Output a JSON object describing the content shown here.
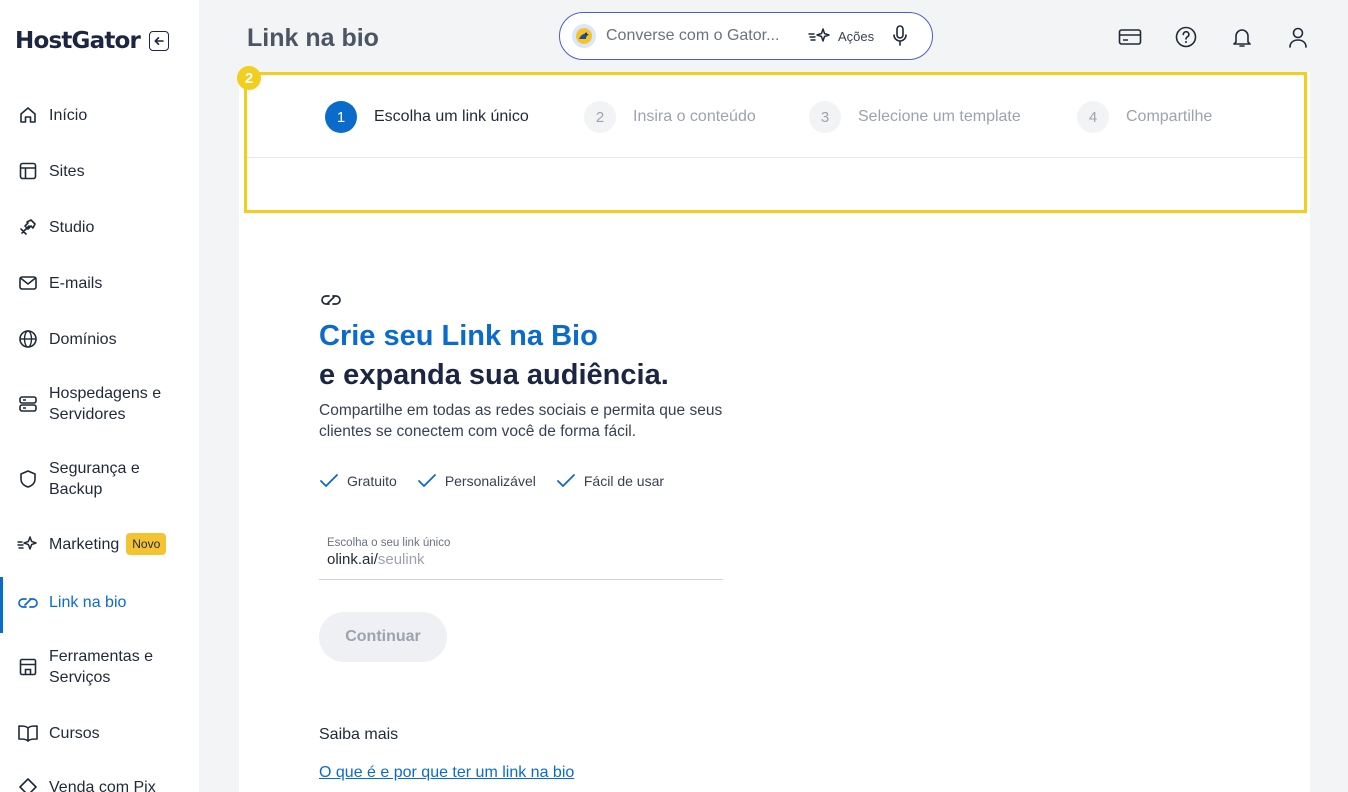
{
  "app": {
    "logo": "HostGator",
    "page_title": "Link na bio"
  },
  "sidebar": {
    "items": [
      {
        "label": "Início",
        "icon": "home-icon"
      },
      {
        "label": "Sites",
        "icon": "layout-icon"
      },
      {
        "label": "Studio",
        "icon": "tools-icon"
      },
      {
        "label": "E-mails",
        "icon": "mail-icon"
      },
      {
        "label": "Domínios",
        "icon": "globe-icon"
      },
      {
        "label": "Hospedagens e Servidores",
        "icon": "server-icon"
      },
      {
        "label": "Segurança e Backup",
        "icon": "shield-icon"
      },
      {
        "label": "Marketing",
        "icon": "sparkle-icon",
        "badge": "Novo"
      },
      {
        "label": "Link na bio",
        "icon": "link-icon",
        "active": true
      },
      {
        "label": "Ferramentas e Serviços",
        "icon": "store-icon"
      },
      {
        "label": "Cursos",
        "icon": "book-icon"
      },
      {
        "label": "Venda com Pix",
        "icon": "pix-icon"
      }
    ]
  },
  "header": {
    "chat_placeholder": "Converse com o Gator...",
    "actions_label": "Ações"
  },
  "steps": {
    "marker": "2",
    "items": [
      {
        "number": "1",
        "label": "Escolha um link único"
      },
      {
        "number": "2",
        "label": "Insira o conteúdo"
      },
      {
        "number": "3",
        "label": "Selecione um template"
      },
      {
        "number": "4",
        "label": "Compartilhe"
      }
    ],
    "current": 1
  },
  "content": {
    "headline_highlight": "Crie seu Link na Bio",
    "headline_rest": "e expanda sua audiência.",
    "description": "Compartilhe em todas as redes sociais e permita que seus clientes se conectem com você de forma fácil.",
    "features": [
      "Gratuito",
      "Personalizável",
      "Fácil de usar"
    ],
    "field_label": "Escolha o seu link único",
    "field_prefix": "olink.ai/",
    "field_placeholder": "seulink",
    "continue_label": "Continuar",
    "learn_more_title": "Saiba mais",
    "learn_more_link": "O que é e por que ter um link na bio"
  },
  "colors": {
    "primary": "#0b6bcb",
    "highlight": "#f2cf1f",
    "badge": "#f5c332",
    "chat_border": "#4f5bd5"
  }
}
